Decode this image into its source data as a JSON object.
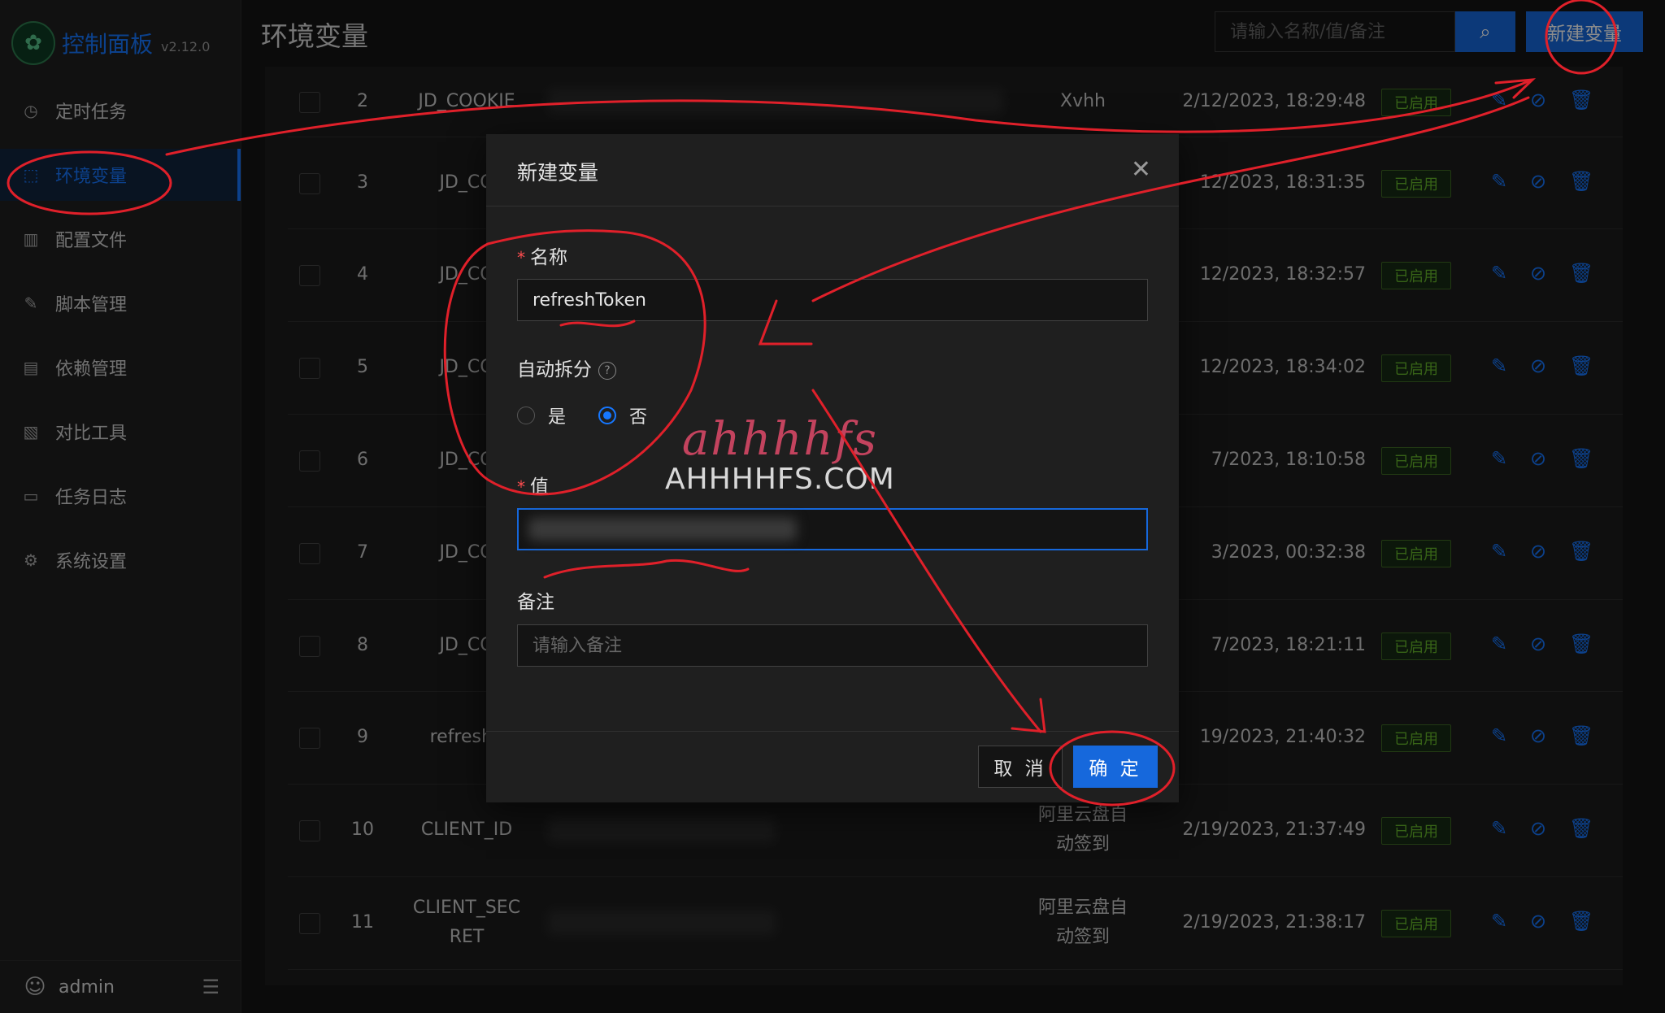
{
  "app": {
    "title": "控制面板",
    "version": "v2.12.0"
  },
  "sidebar": {
    "items": [
      {
        "label": "定时任务",
        "icon": "clock-icon"
      },
      {
        "label": "环境变量",
        "icon": "variable-icon",
        "active": true
      },
      {
        "label": "配置文件",
        "icon": "sliders-icon"
      },
      {
        "label": "脚本管理",
        "icon": "edit-icon"
      },
      {
        "label": "依赖管理",
        "icon": "file-icon"
      },
      {
        "label": "对比工具",
        "icon": "diff-icon"
      },
      {
        "label": "任务日志",
        "icon": "folder-icon"
      },
      {
        "label": "系统设置",
        "icon": "gear-icon"
      }
    ],
    "user": "admin"
  },
  "header": {
    "title": "环境变量",
    "search_placeholder": "请输入名称/值/备注",
    "new_button": "新建变量"
  },
  "table": {
    "rows": [
      {
        "num": "2",
        "name": "JD_COOKIE",
        "remark": "Xvhh",
        "time": "2/12/2023, 18:29:48",
        "status": "已启用"
      },
      {
        "num": "3",
        "name": "JD_CO",
        "remark": "",
        "time": "12/2023, 18:31:35",
        "status": "已启用"
      },
      {
        "num": "4",
        "name": "JD_CO",
        "remark": "",
        "time": "12/2023, 18:32:57",
        "status": "已启用"
      },
      {
        "num": "5",
        "name": "JD_CO",
        "remark": "",
        "time": "12/2023, 18:34:02",
        "status": "已启用"
      },
      {
        "num": "6",
        "name": "JD_CO",
        "remark": "",
        "time": "7/2023, 18:10:58",
        "status": "已启用"
      },
      {
        "num": "7",
        "name": "JD_CO",
        "remark": "",
        "time": "3/2023, 00:32:38",
        "status": "已启用"
      },
      {
        "num": "8",
        "name": "JD_CO",
        "remark": "",
        "time": "7/2023, 18:21:11",
        "status": "已启用"
      },
      {
        "num": "9",
        "name": "refreshT",
        "remark": "",
        "time": "19/2023, 21:40:32",
        "status": "已启用"
      },
      {
        "num": "10",
        "name": "CLIENT_ID",
        "remark": "阿里云盘自动签到",
        "time": "2/19/2023, 21:37:49",
        "status": "已启用"
      },
      {
        "num": "11",
        "name": "CLIENT_SECRET",
        "remark": "阿里云盘自动签到",
        "time": "2/19/2023, 21:38:17",
        "status": "已启用"
      }
    ]
  },
  "modal": {
    "title": "新建变量",
    "name_label": "名称",
    "name_value": "refreshToken",
    "split_label": "自动拆分",
    "split_yes": "是",
    "split_no": "否",
    "split_selected": "否",
    "value_label": "值",
    "remark_label": "备注",
    "remark_placeholder": "请输入备注",
    "cancel": "取 消",
    "ok": "确 定"
  },
  "watermark": {
    "top": "ahhhhfs",
    "bottom": "AHHHHFS.COM"
  },
  "colors": {
    "accent": "#1668dc",
    "status_green": "#65b52b",
    "annotation": "#e0202a"
  }
}
